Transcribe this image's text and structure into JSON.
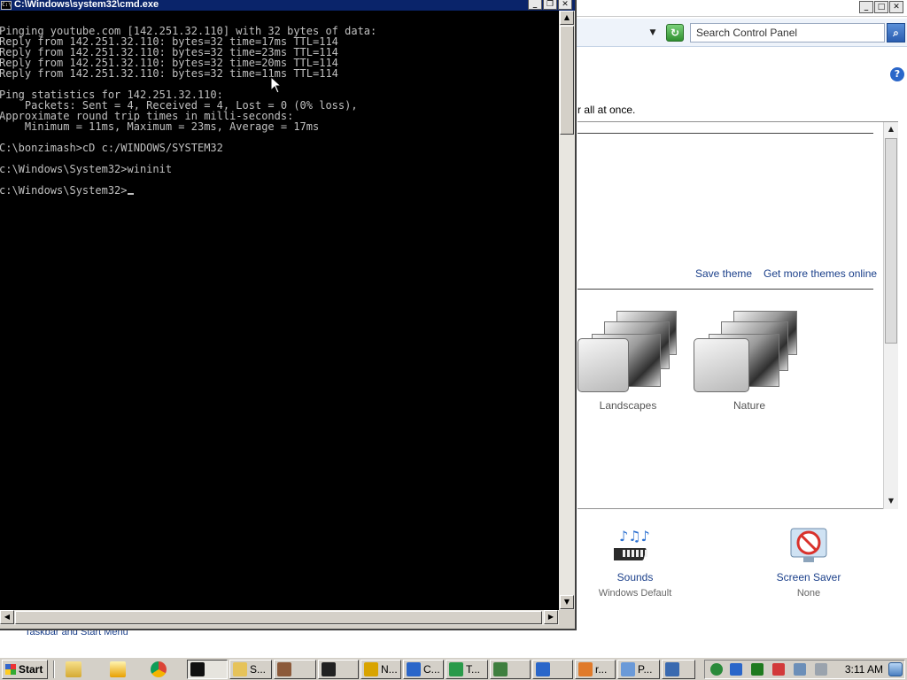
{
  "control_panel": {
    "search_placeholder": "Search Control Panel",
    "description_fragment": "r all at once.",
    "theme_links": {
      "save": "Save theme",
      "more": "Get more themes online"
    },
    "themes": [
      {
        "name": "Landscapes"
      },
      {
        "name": "Nature"
      }
    ],
    "bottom_items": [
      {
        "title": "Sounds",
        "subtitle": "Windows Default",
        "icon": "sounds-icon"
      },
      {
        "title": "Screen Saver",
        "subtitle": "None",
        "icon": "screen-saver-icon"
      }
    ],
    "see_also_link": "Taskbar and Start Menu"
  },
  "cmd": {
    "title": "C:\\Windows\\system32\\cmd.exe",
    "lines": [
      "Pinging youtube.com [142.251.32.110] with 32 bytes of data:",
      "Reply from 142.251.32.110: bytes=32 time=17ms TTL=114",
      "Reply from 142.251.32.110: bytes=32 time=23ms TTL=114",
      "Reply from 142.251.32.110: bytes=32 time=20ms TTL=114",
      "Reply from 142.251.32.110: bytes=32 time=11ms TTL=114",
      "",
      "Ping statistics for 142.251.32.110:",
      "    Packets: Sent = 4, Received = 4, Lost = 0 (0% loss),",
      "Approximate round trip times in milli-seconds:",
      "    Minimum = 11ms, Maximum = 23ms, Average = 17ms",
      "",
      "C:\\bonzimash>cD c:/WINDOWS/SYSTEM32",
      "",
      "c:\\Windows\\System32>wininit",
      "",
      "c:\\Windows\\System32>"
    ]
  },
  "taskbar": {
    "start_label": "Start",
    "tasks": [
      {
        "label": "",
        "icon": "cmd-icon"
      },
      {
        "label": "S...",
        "icon": "folder-icon"
      },
      {
        "label": "",
        "icon": "app-icon"
      },
      {
        "label": "",
        "icon": "7zip-icon"
      },
      {
        "label": "N...",
        "icon": "notepad-icon"
      },
      {
        "label": "C...",
        "icon": "shield-icon"
      },
      {
        "label": "T...",
        "icon": "timer-icon"
      },
      {
        "label": "",
        "icon": "network-icon"
      },
      {
        "label": "",
        "icon": "shield-icon"
      },
      {
        "label": "r...",
        "icon": "browser-icon"
      },
      {
        "label": "P...",
        "icon": "document-icon"
      },
      {
        "label": "",
        "icon": "monitor-icon"
      }
    ],
    "clock": "3:11 AM"
  }
}
